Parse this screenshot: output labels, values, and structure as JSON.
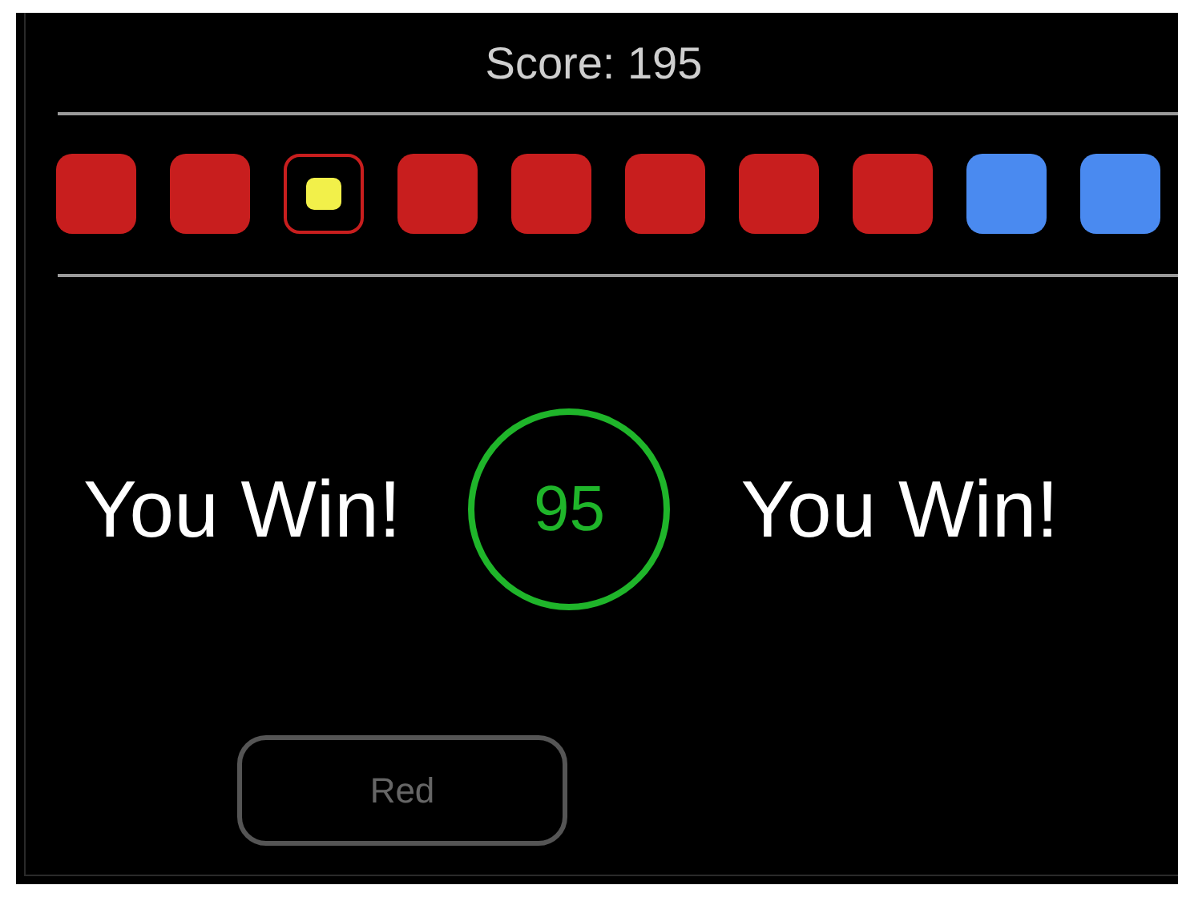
{
  "score": "Score: 195",
  "tiles": [
    {
      "color": "#c81e1e",
      "selected": false
    },
    {
      "color": "#c81e1e",
      "selected": false
    },
    {
      "color": "#c81e1e",
      "selected": true
    },
    {
      "color": "#c81e1e",
      "selected": false
    },
    {
      "color": "#c81e1e",
      "selected": false
    },
    {
      "color": "#c81e1e",
      "selected": false
    },
    {
      "color": "#c81e1e",
      "selected": false
    },
    {
      "color": "#c81e1e",
      "selected": false
    },
    {
      "color": "#4a8af0",
      "selected": false
    },
    {
      "color": "#4a8af0",
      "selected": false
    }
  ],
  "result_left": "You Win!",
  "timer": "95",
  "result_right": "You Win!",
  "button": {
    "label": "Red",
    "disabled": true
  }
}
